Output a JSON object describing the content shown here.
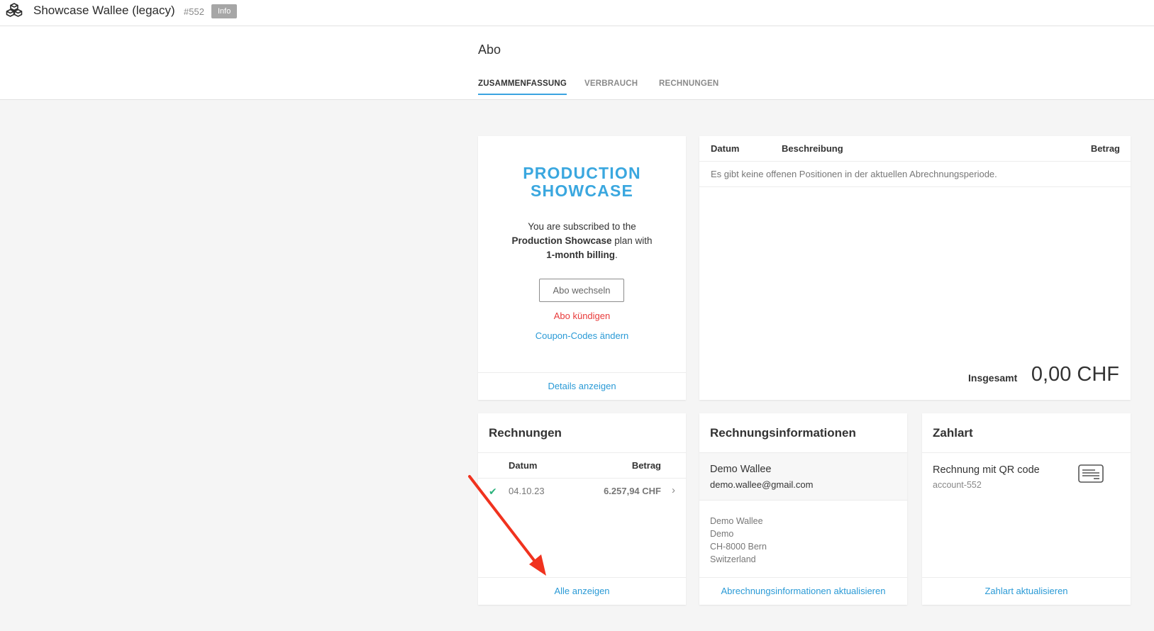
{
  "topbar": {
    "app_title": "Showcase Wallee (legacy)",
    "app_id": "#552",
    "info_badge": "Info",
    "logo_icon": "cubes-icon"
  },
  "header": {
    "page_title": "Abo",
    "tabs": [
      {
        "label": "ZUSAMMENFASSUNG",
        "active": true
      },
      {
        "label": "VERBRAUCH",
        "active": false
      },
      {
        "label": "RECHNUNGEN",
        "active": false
      }
    ]
  },
  "plan": {
    "name_line1": "PRODUCTION",
    "name_line2": "SHOWCASE",
    "desc_prefix": "You are subscribed to the",
    "plan_name": "Production Showcase",
    "desc_middle": "plan with",
    "billing": "1-month billing",
    "desc_suffix": ".",
    "change_button": "Abo wechseln",
    "cancel_link": "Abo kündigen",
    "coupon_link": "Coupon-Codes ändern",
    "details_link": "Details anzeigen"
  },
  "positions": {
    "col_date": "Datum",
    "col_description": "Beschreibung",
    "col_amount": "Betrag",
    "empty_message": "Es gibt keine offenen Positionen in der aktuellen Abrechnungsperiode.",
    "total_label": "Insgesamt",
    "total_value": "0,00 CHF"
  },
  "invoices": {
    "title": "Rechnungen",
    "col_date": "Datum",
    "col_amount": "Betrag",
    "rows": [
      {
        "status_icon": "check-icon",
        "date": "04.10.23",
        "amount": "6.257,94 CHF"
      }
    ],
    "show_all_link": "Alle anzeigen"
  },
  "billing_info": {
    "title": "Rechnungsinformationen",
    "name": "Demo Wallee",
    "email": "demo.wallee@gmail.com",
    "address": [
      "Demo Wallee",
      "Demo",
      "CH-8000 Bern",
      "Switzerland"
    ],
    "update_link": "Abrechnungsinformationen aktualisieren"
  },
  "payment": {
    "title": "Zahlart",
    "method": "Rechnung mit QR code",
    "reference": "account-552",
    "icon": "invoice-card-icon",
    "update_link": "Zahlart aktualisieren"
  },
  "colors": {
    "accent": "#3aa7df",
    "link": "#2a9ad6",
    "danger": "#e83a3a",
    "success": "#2ab27b",
    "annotation_arrow": "#f0321e"
  }
}
